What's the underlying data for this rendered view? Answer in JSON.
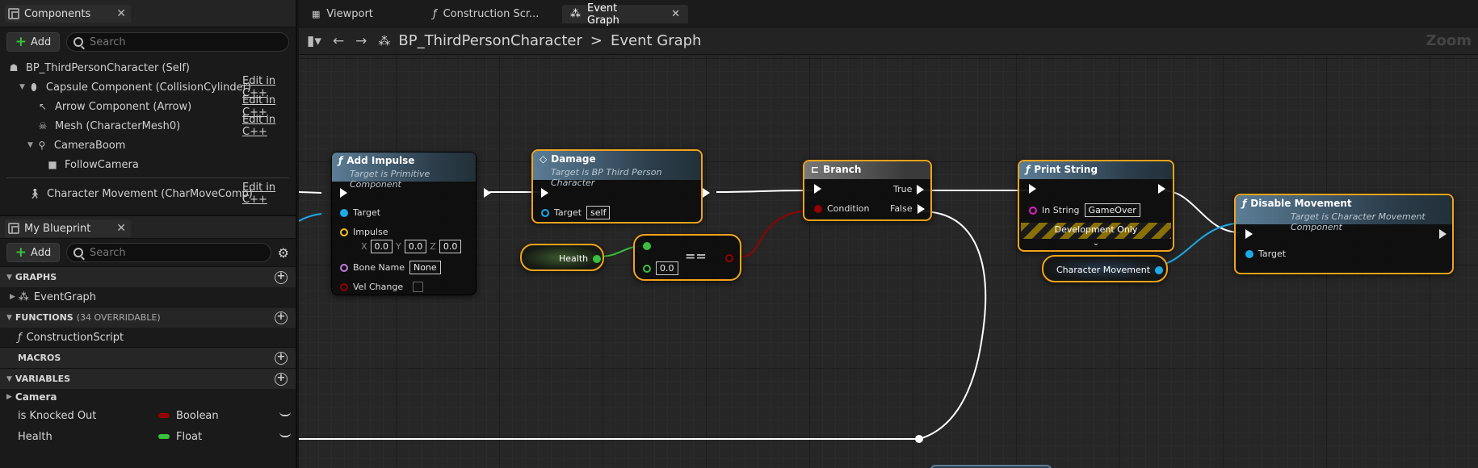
{
  "components_panel": {
    "title": "Components",
    "add_label": "Add",
    "search_placeholder": "Search",
    "root": "BP_ThirdPersonCharacter (Self)",
    "items": [
      {
        "label": "Capsule Component (CollisionCylinder)",
        "action": "Edit in C++"
      },
      {
        "label": "Arrow Component (Arrow)",
        "action": "Edit in C++"
      },
      {
        "label": "Mesh (CharacterMesh0)",
        "action": "Edit in C++"
      },
      {
        "label": "CameraBoom",
        "action": ""
      },
      {
        "label": "FollowCamera",
        "action": ""
      },
      {
        "label": "Character Movement (CharMoveComp)",
        "action": "Edit in C++"
      }
    ]
  },
  "blueprint_panel": {
    "title": "My Blueprint",
    "add_label": "Add",
    "search_placeholder": "Search",
    "graphs_label": "GRAPHS",
    "graph_item": "EventGraph",
    "functions_label": "FUNCTIONS",
    "functions_sub": "(34 OVERRIDABLE)",
    "function_item": "ConstructionScript",
    "macros_label": "MACROS",
    "variables_label": "VARIABLES",
    "category": "Camera",
    "variables": [
      {
        "name": "is Knocked Out",
        "type": "Boolean",
        "color": "#950000"
      },
      {
        "name": "Health",
        "type": "Float",
        "color": "#39c03d"
      }
    ]
  },
  "tabs": {
    "viewport": "Viewport",
    "construction": "Construction Scr...",
    "event_graph": "Event Graph"
  },
  "toolbar": {
    "blueprint": "BP_ThirdPersonCharacter",
    "separator": ">",
    "graph": "Event Graph",
    "zoom": "Zoom"
  },
  "nodes": {
    "add_impulse": {
      "title": "Add Impulse",
      "subtitle": "Target is Primitive Component",
      "target": "Target",
      "impulse": "Impulse",
      "x": "0.0",
      "y": "0.0",
      "z": "0.0",
      "xl": "X",
      "yl": "Y",
      "zl": "Z",
      "bone_name": "Bone Name",
      "bone_value": "None",
      "vel_change": "Vel Change"
    },
    "damage": {
      "title": "Damage",
      "subtitle": "Target is BP Third Person Character",
      "target": "Target",
      "target_value": "self"
    },
    "branch": {
      "title": "Branch",
      "true": "True",
      "false": "False",
      "condition": "Condition"
    },
    "print_string": {
      "title": "Print String",
      "in_string": "In String",
      "value": "GameOver",
      "dev": "Development Only"
    },
    "disable_movement": {
      "title": "Disable Movement",
      "subtitle": "Target is Character Movement Component",
      "target": "Target"
    },
    "health": {
      "label": "Health"
    },
    "equals": {
      "op": "==",
      "value": "0.0"
    },
    "character_movement": {
      "label": "Character Movement"
    }
  },
  "colors": {
    "exec": "#ffffff",
    "object": "#1ea9e6",
    "float": "#39c03d",
    "bool": "#950000",
    "string": "#e01fc7",
    "struct": "#f2c21b",
    "selection": "#f2a31a"
  }
}
